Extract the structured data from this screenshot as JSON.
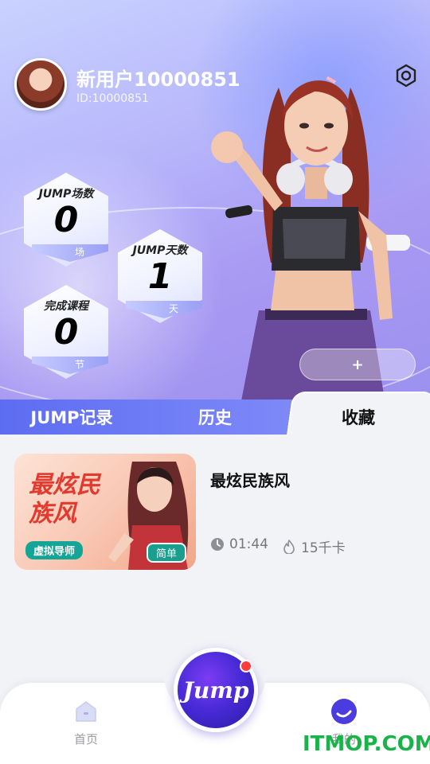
{
  "profile": {
    "username": "新用户10000851",
    "user_id": "ID:10000851"
  },
  "stats": [
    {
      "label": "JUMP场数",
      "value": "0",
      "unit": "场"
    },
    {
      "label": "JUMP天数",
      "value": "1",
      "unit": "天"
    },
    {
      "label": "完成课程",
      "value": "0",
      "unit": "节"
    }
  ],
  "hero": {
    "add_label": "+"
  },
  "tabs": [
    {
      "label": "JUMP记录",
      "active": false
    },
    {
      "label": "历史",
      "active": false
    },
    {
      "label": "收藏",
      "active": true
    }
  ],
  "favorites": [
    {
      "thumb_title": "最炫民族风",
      "thumb_tag": "虚拟导师",
      "thumb_level": "简单",
      "title": "最炫民族风",
      "duration": "01:44",
      "calories": "15千卡"
    }
  ],
  "nav": {
    "home_label": "首页",
    "center_label": "Jump",
    "me_label": "我的"
  },
  "watermark": "ITMOP.COM",
  "icons": {
    "settings": "gear-icon",
    "clock": "clock-icon",
    "flame": "flame-icon",
    "home": "home-icon",
    "me": "profile-icon"
  },
  "colors": {
    "accent": "#5d6df2",
    "tag_green": "#14a596",
    "thumb_title": "#e23a2e",
    "watermark": "#19b34a",
    "notification_dot": "#ff3b3b"
  }
}
